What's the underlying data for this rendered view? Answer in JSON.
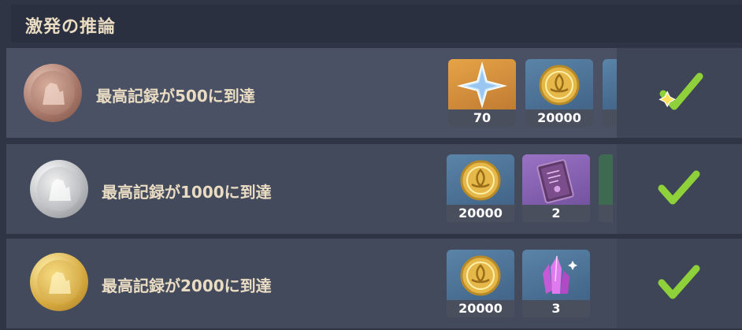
{
  "header": {
    "title": "激発の推論"
  },
  "rows": [
    {
      "label": "最高記録が500に到達",
      "medal": "bronze-medal-icon",
      "completed": true,
      "rewards": [
        {
          "icon": "primogem-icon",
          "count": "70"
        },
        {
          "icon": "mora-coin-icon",
          "count": "20000"
        }
      ]
    },
    {
      "label": "最高記録が1000に到達",
      "medal": "silver-medal-icon",
      "completed": true,
      "rewards": [
        {
          "icon": "mora-coin-icon",
          "count": "20000"
        },
        {
          "icon": "purple-book-icon",
          "count": "2"
        }
      ]
    },
    {
      "label": "最高記録が2000に到達",
      "medal": "gold-medal-icon",
      "completed": true,
      "rewards": [
        {
          "icon": "mora-coin-icon",
          "count": "20000"
        },
        {
          "icon": "purple-crystal-icon",
          "count": "3"
        }
      ]
    }
  ],
  "colors": {
    "title_text": "#e9dcc2",
    "check_green": "#8fd13a",
    "gold_bg": "#d18d3a",
    "blue_bg": "#4a7096",
    "purple_bg": "#7e5aae"
  }
}
